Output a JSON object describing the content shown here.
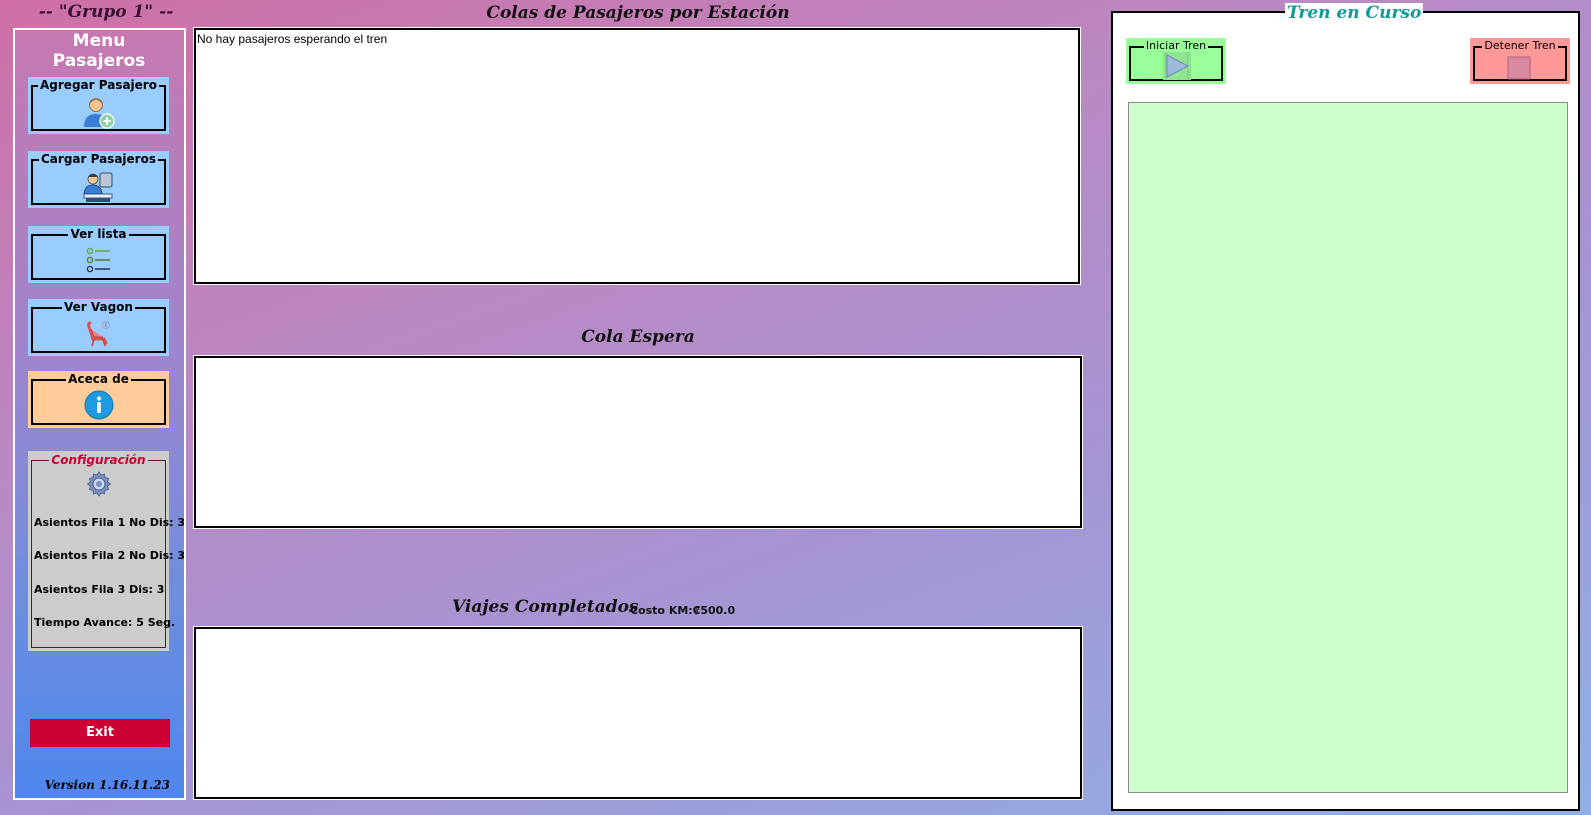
{
  "app": {
    "group_title": "-- \"Grupo 1\" --",
    "version": "Version 1.16.11.23"
  },
  "menu": {
    "title": "Menu Pasajeros",
    "buttons": [
      {
        "label": "Agregar Pasajero",
        "icon": "add-user-icon"
      },
      {
        "label": "Cargar Pasajeros",
        "icon": "load-passengers-icon"
      },
      {
        "label": "Ver lista",
        "icon": "list-icon"
      },
      {
        "label": "Ver Vagon",
        "icon": "seat-icon"
      },
      {
        "label": "Aceca de",
        "icon": "info-icon"
      }
    ],
    "exit_label": "Exit"
  },
  "config": {
    "title": "Configuración",
    "icon": "gear-icon",
    "lines": [
      "Asientos Fila 1 No Dis: 3",
      "Asientos Fila 2 No Dis: 3",
      "Asientos Fila 3  Dis:  3",
      "Tiempo Avance: 5 Seg."
    ]
  },
  "center": {
    "stations_title": "Colas de Pasajeros por Estación",
    "stations_text": "No hay pasajeros esperando el tren",
    "waiting_title": "Cola Espera",
    "waiting_text": "",
    "completed_title": "Viajes Completados",
    "cost_label": "Costo KM:₡500.0",
    "completed_text": ""
  },
  "train": {
    "title": "Tren en Curso",
    "start_label": "Iniciar Tren",
    "stop_label": "Detener Tren"
  },
  "colors": {
    "menu_button": "#99ccff",
    "about_button": "#ffcc99",
    "config_title": "#cc0033",
    "exit_button": "#cc0033",
    "train_title": "#119999",
    "start_button": "#99ff99",
    "stop_button": "#ff9999",
    "train_area": "#ccffcc"
  }
}
